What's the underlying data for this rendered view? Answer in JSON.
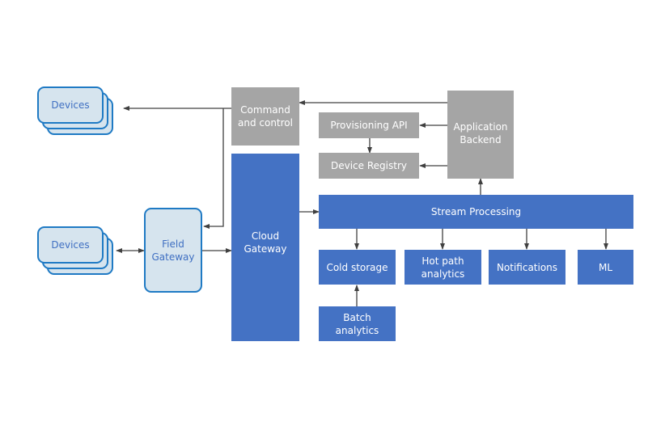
{
  "diagram": {
    "devices_top": {
      "label": "Devices"
    },
    "devices_bottom": {
      "label": "Devices"
    },
    "field_gateway": {
      "label": "Field\nGateway"
    },
    "command_control": {
      "label": "Command\nand control"
    },
    "cloud_gateway": {
      "label": "Cloud\nGateway"
    },
    "provisioning_api": {
      "label": "Provisioning API"
    },
    "device_registry": {
      "label": "Device Registry"
    },
    "application_backend": {
      "label": "Application\nBackend"
    },
    "stream_processing": {
      "label": "Stream Processing"
    },
    "cold_storage": {
      "label": "Cold storage"
    },
    "hot_path": {
      "label": "Hot path\nanalytics"
    },
    "notifications": {
      "label": "Notifications"
    },
    "ml": {
      "label": "ML"
    },
    "batch_analytics": {
      "label": "Batch\nanalytics"
    }
  },
  "colors": {
    "primary_blue": "#4472c4",
    "gray": "#a5a5a5",
    "light_blue_fill": "#d6e4ee",
    "light_blue_border": "#1f7ac4",
    "arrow": "#404040"
  }
}
